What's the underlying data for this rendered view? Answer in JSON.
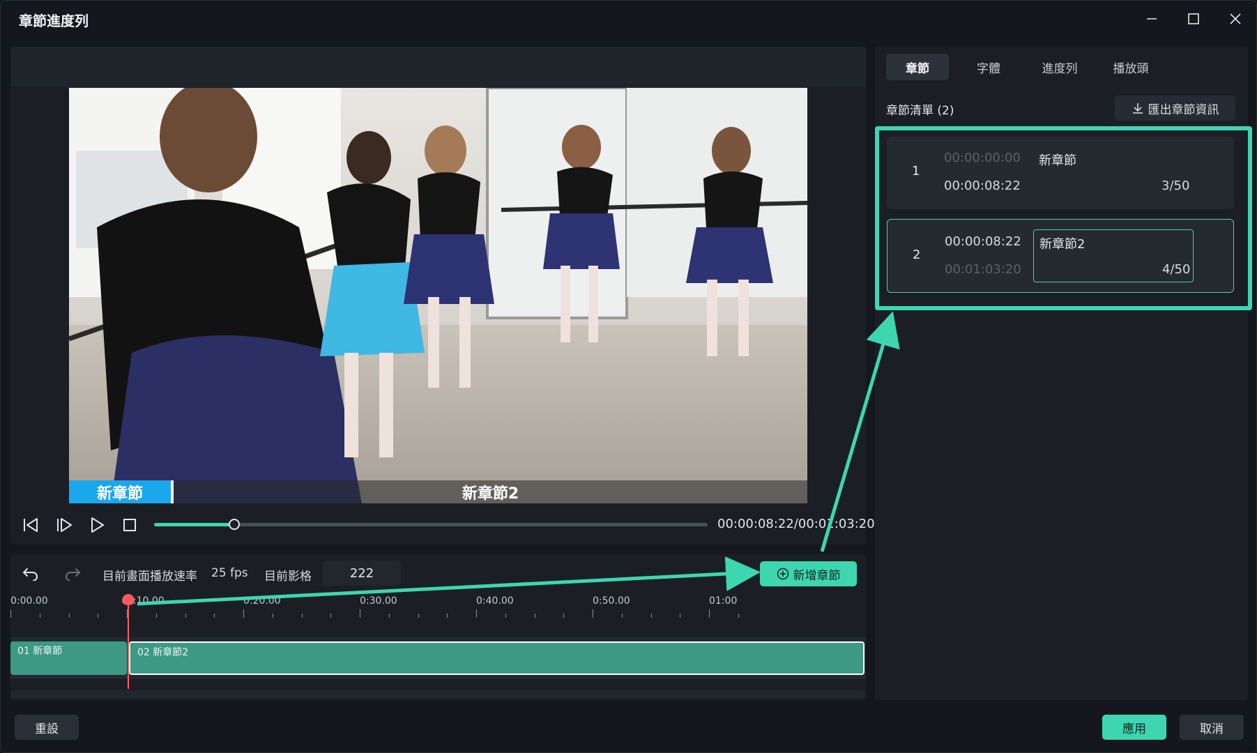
{
  "window": {
    "title": "章節進度列"
  },
  "preview": {
    "chapter_bar": [
      "新章節",
      "新章節2"
    ],
    "timecode": "00:00:08:22/00:01:03:20",
    "progress_fraction": 0.145
  },
  "timeline": {
    "fps_label": "目前畫面播放速率",
    "fps_value": "25 fps",
    "frame_label": "目前影格",
    "frame_value": "222",
    "add_chapter_label": "新增章節",
    "ruler_labels": [
      "0:00.00",
      "0:10.00",
      "0:20.00",
      "0:30.00",
      "0:40.00",
      "0:50.00",
      "01:00"
    ],
    "clips": [
      {
        "label": "01 新章節"
      },
      {
        "label": "02 新章節2"
      }
    ]
  },
  "right_panel": {
    "tabs": [
      "章節",
      "字體",
      "進度列",
      "播放頭"
    ],
    "list_title": "章節清單 (2)",
    "export_label": "匯出章節資訊",
    "chapters": [
      {
        "num": "1",
        "start": "00:00:00:00",
        "end": "00:00:08:22",
        "name": "新章節",
        "count": "3/50"
      },
      {
        "num": "2",
        "start": "00:00:08:22",
        "end": "00:01:03:20",
        "name": "新章節2",
        "count": "4/50"
      }
    ]
  },
  "footer": {
    "reset": "重設",
    "apply": "應用",
    "cancel": "取消"
  },
  "colors": {
    "accent": "#3ed6b0",
    "chapter_blue": "#1aa7ec",
    "playhead": "#ff5a5f",
    "clip": "#3d9984"
  }
}
